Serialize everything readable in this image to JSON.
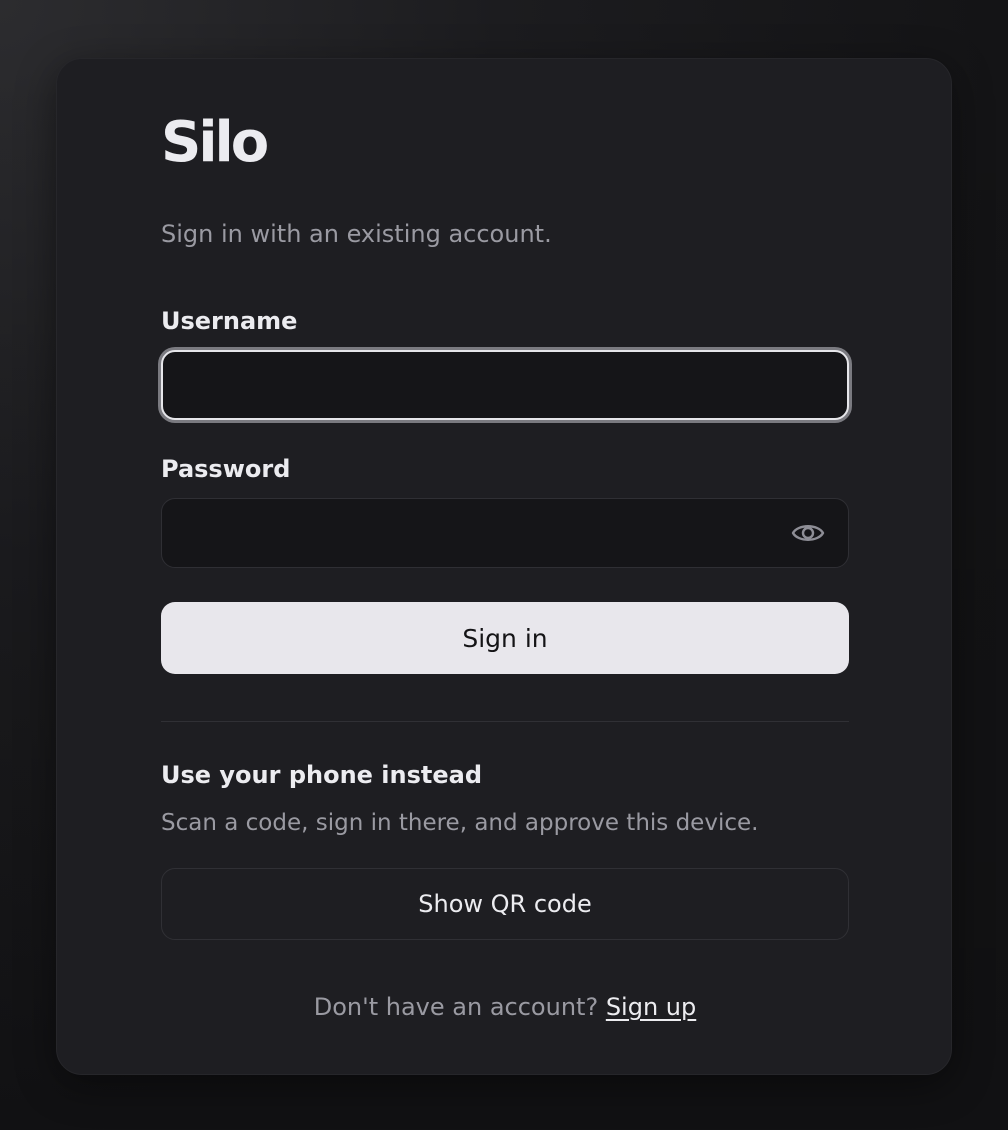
{
  "brand": {
    "logo_text": "Silo"
  },
  "signin": {
    "subtitle": "Sign in with an existing account.",
    "username_label": "Username",
    "username_value": "",
    "password_label": "Password",
    "password_value": "",
    "password_toggle_icon": "eye-icon",
    "submit_label": "Sign in"
  },
  "phone": {
    "title": "Use your phone instead",
    "description": "Scan a code, sign in there, and approve this device.",
    "qr_button_label": "Show QR code"
  },
  "footer": {
    "prompt": "Don't have an account?",
    "signup_link": "Sign up"
  },
  "colors": {
    "background": "#141416",
    "card": "#1e1e22",
    "input": "#151518",
    "primary_button": "#e8e7ec",
    "muted_text": "#9a9aa2",
    "text": "#ececf0"
  }
}
